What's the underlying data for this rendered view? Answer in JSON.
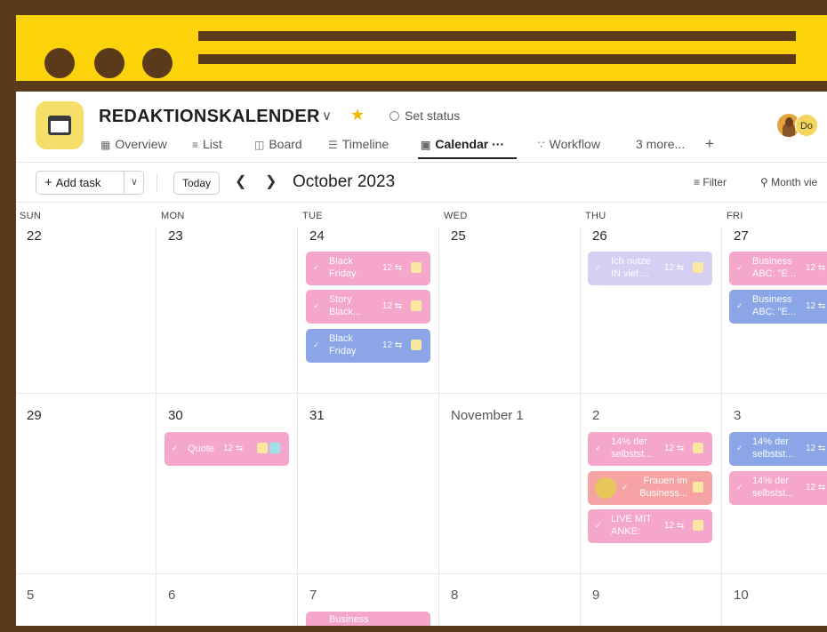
{
  "app": {
    "project_title": "REDAKTIONSKALENDER",
    "set_status": "Set status",
    "avatar_initials": "Do",
    "tabs": [
      {
        "icon": "overview-icon",
        "label": "Overview"
      },
      {
        "icon": "list-icon",
        "label": "List"
      },
      {
        "icon": "board-icon",
        "label": "Board"
      },
      {
        "icon": "timeline-icon",
        "label": "Timeline"
      },
      {
        "icon": "calendar-icon",
        "label": "Calendar ···"
      },
      {
        "icon": "workflow-icon",
        "label": "Workflow"
      },
      {
        "icon": "",
        "label": "3 more..."
      }
    ],
    "active_tab": "Calendar"
  },
  "toolbar": {
    "add_task": "Add task",
    "today": "Today",
    "month_label": "October 2023",
    "filter": "Filter",
    "month_view": "Month vie"
  },
  "calendar": {
    "weekdays": [
      "SUN",
      "MON",
      "TUE",
      "WED",
      "THU",
      "FRI"
    ],
    "weeks": [
      [
        "22",
        "23",
        "24",
        "25",
        "26",
        "27"
      ],
      [
        "29",
        "30",
        "31",
        "November 1",
        "2",
        "3"
      ],
      [
        "5",
        "6",
        "7",
        "8",
        "9",
        "10"
      ]
    ],
    "tasks": {
      "t1": {
        "title": "Black Friday",
        "count": "12"
      },
      "t2": {
        "title": "Story Black...",
        "count": "12"
      },
      "t3": {
        "title": "Black Friday",
        "count": "12"
      },
      "t4": {
        "title": "Ich nutze IN viel ...",
        "count": "12"
      },
      "t5": {
        "title": "Business ABC: \"E...",
        "count": "12"
      },
      "t6": {
        "title": "Business ABC: \"E...",
        "count": "12"
      },
      "t7": {
        "title": "Quote",
        "count": "12"
      },
      "t8": {
        "title": "14% der selbstst...",
        "count": "12"
      },
      "t9": {
        "title": "Frauen im Business...",
        "count": ""
      },
      "t10": {
        "title": "LIVE MIT ANKE:",
        "count": "12"
      },
      "t11": {
        "title": "14% der selbstst...",
        "count": "12"
      },
      "t12": {
        "title": "14% der selbstst...",
        "count": "12"
      },
      "t13": {
        "title": "Business",
        "count": ""
      }
    }
  },
  "colors": {
    "frame_brown": "#5b3a1a",
    "banner_yellow": "#fcd20a",
    "task_pink": "#f4a6cb",
    "task_blue": "#8aa6e6",
    "task_lavender": "#d6cff4",
    "task_salmon": "#f5a3a3"
  }
}
